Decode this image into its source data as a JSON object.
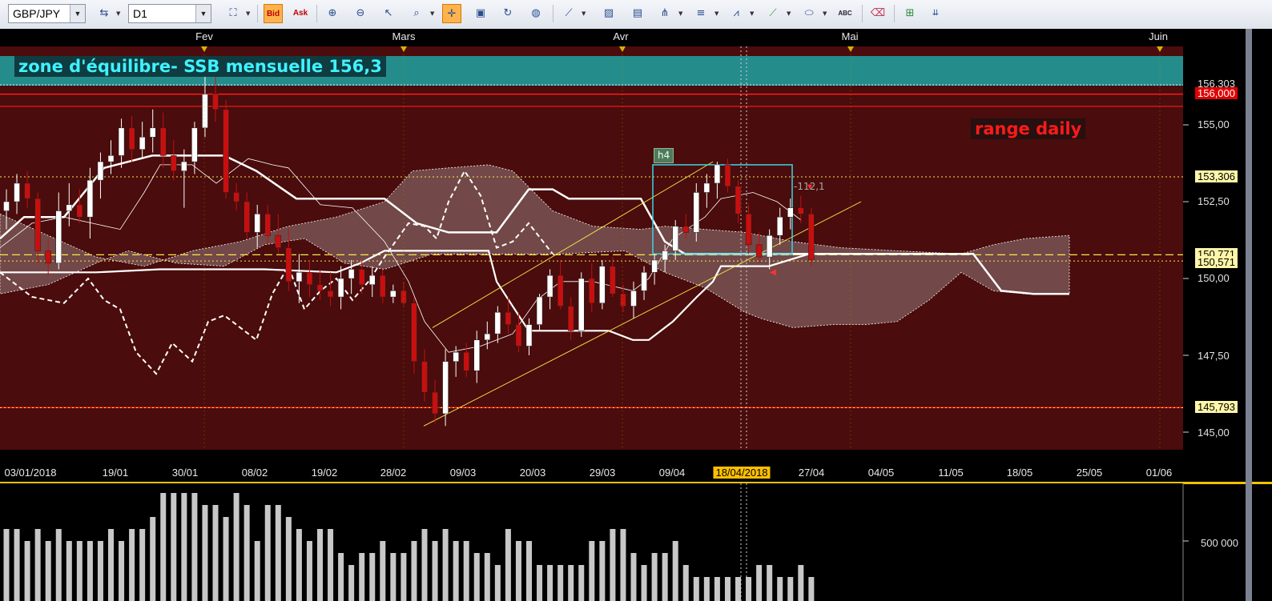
{
  "toolbar": {
    "symbol": "GBP/JPY",
    "timeframe": "D1",
    "bid_label": "Bid",
    "ask_label": "Ask",
    "abc_label": "ABC",
    "icons": [
      "connection-icon",
      "chart-type-icon",
      "bid-icon",
      "ask-icon",
      "zoom-in-icon",
      "zoom-out-icon",
      "cursor-icon",
      "magnifier-icon",
      "crosshair-icon",
      "screenshot-icon",
      "refresh-icon",
      "globe-icon",
      "ruler-icon",
      "image-icon",
      "template-icon",
      "pitchfork-icon",
      "horizontal-lines-icon",
      "fan-icon",
      "trendline-icon",
      "ellipse-icon",
      "text-tool-icon",
      "eraser-icon",
      "tree-icon",
      "more-icon"
    ]
  },
  "colors": {
    "background": "#4a0c0c",
    "zone_band": "#1ea3a3",
    "cloud": "#7a5454",
    "red_line": "#ff1a1a",
    "yellow_line": "#f7e84a",
    "candle_up": "#ffffff",
    "candle_down": "#c80f0f"
  },
  "month_labels": [
    "Fev",
    "Mars",
    "Avr",
    "Mai",
    "Juin"
  ],
  "date_labels": [
    "03/01/2018",
    "19/01",
    "30/01",
    "08/02",
    "19/02",
    "28/02",
    "09/03",
    "20/03",
    "29/03",
    "09/04",
    "18/04/2018",
    "27/04",
    "04/05",
    "11/05",
    "18/05",
    "25/05",
    "01/06"
  ],
  "annotations": {
    "zone": "zone d'équilibre- SSB mensuelle 156,3",
    "range": "range daily",
    "h4": "h4",
    "diff": "-112,1"
  },
  "price_labels": {
    "top_cut": "156,303",
    "p156": "156,000",
    "p155": "155,00",
    "p153306": "153,306",
    "p1525": "152,50",
    "p150771": "150,771",
    "p150571": "150,571",
    "p150": "150,00",
    "p1475": "147,50",
    "p145793": "145,793",
    "p145": "145,00"
  },
  "volume_label": "500 000",
  "chart_data": {
    "type": "candlestick",
    "symbol": "GBP/JPY",
    "timeframe": "D1",
    "ylim": [
      144.6,
      157.0
    ],
    "yticks": [
      145.0,
      147.5,
      150.0,
      152.5,
      155.0
    ],
    "levels": {
      "zone_top": 156.3,
      "red_upper": 156.0,
      "red_lower": 145.8,
      "dotted_153": 153.306,
      "dotted_150": 150.571,
      "yellow_dash": 150.771,
      "dotted_145": 145.793
    },
    "candles": [
      [
        152.2,
        152.9,
        151.6,
        152.5
      ],
      [
        152.5,
        153.4,
        152.1,
        153.1
      ],
      [
        153.1,
        153.5,
        152.3,
        152.6
      ],
      [
        152.6,
        152.8,
        150.5,
        150.9
      ],
      [
        150.9,
        151.3,
        150.1,
        150.5
      ],
      [
        150.5,
        152.8,
        150.3,
        152.2
      ],
      [
        152.2,
        153.1,
        151.7,
        152.4
      ],
      [
        152.4,
        152.9,
        151.8,
        152.0
      ],
      [
        152.0,
        153.6,
        151.3,
        153.2
      ],
      [
        153.2,
        154.1,
        152.6,
        153.8
      ],
      [
        153.8,
        154.5,
        153.4,
        154.0
      ],
      [
        154.0,
        155.2,
        153.6,
        154.9
      ],
      [
        154.9,
        155.3,
        153.8,
        154.2
      ],
      [
        154.2,
        155.1,
        153.9,
        154.6
      ],
      [
        154.6,
        155.5,
        154.1,
        154.9
      ],
      [
        154.9,
        155.4,
        153.6,
        154.0
      ],
      [
        154.0,
        154.5,
        153.2,
        153.5
      ],
      [
        153.5,
        154.2,
        152.3,
        153.8
      ],
      [
        153.8,
        155.1,
        153.4,
        154.9
      ],
      [
        154.9,
        156.7,
        154.6,
        156.0
      ],
      [
        156.0,
        156.6,
        155.1,
        155.5
      ],
      [
        155.5,
        155.8,
        152.6,
        152.8
      ],
      [
        152.8,
        153.1,
        152.2,
        152.5
      ],
      [
        152.5,
        152.8,
        151.3,
        151.5
      ],
      [
        151.5,
        152.4,
        151.0,
        152.1
      ],
      [
        152.1,
        152.4,
        151.1,
        151.4
      ],
      [
        151.4,
        152.1,
        150.8,
        151.0
      ],
      [
        151.0,
        151.6,
        149.6,
        149.9
      ],
      [
        149.9,
        150.8,
        149.2,
        150.2
      ],
      [
        150.2,
        150.6,
        149.4,
        149.8
      ],
      [
        149.8,
        150.3,
        149.3,
        149.6
      ],
      [
        149.6,
        150.2,
        149.1,
        149.4
      ],
      [
        149.4,
        150.4,
        149.0,
        150.0
      ],
      [
        150.0,
        150.6,
        149.5,
        150.3
      ],
      [
        150.3,
        150.6,
        149.5,
        149.8
      ],
      [
        149.8,
        150.4,
        149.4,
        150.1
      ],
      [
        150.1,
        150.3,
        149.2,
        149.4
      ],
      [
        149.4,
        149.8,
        149.2,
        149.6
      ],
      [
        149.6,
        149.9,
        149.1,
        149.2
      ],
      [
        149.2,
        149.4,
        146.9,
        147.3
      ],
      [
        147.3,
        147.7,
        146.0,
        146.3
      ],
      [
        146.3,
        146.7,
        145.3,
        145.6
      ],
      [
        145.6,
        147.7,
        145.2,
        147.3
      ],
      [
        147.3,
        147.8,
        146.8,
        147.6
      ],
      [
        147.6,
        147.9,
        146.8,
        147.0
      ],
      [
        147.0,
        148.3,
        146.6,
        148.0
      ],
      [
        148.0,
        148.6,
        147.7,
        148.2
      ],
      [
        148.2,
        149.1,
        147.9,
        148.9
      ],
      [
        148.9,
        149.4,
        148.2,
        148.5
      ],
      [
        148.5,
        148.9,
        147.6,
        147.8
      ],
      [
        147.8,
        148.7,
        147.5,
        148.5
      ],
      [
        148.5,
        149.5,
        148.3,
        149.4
      ],
      [
        149.4,
        150.3,
        149.0,
        150.1
      ],
      [
        150.1,
        150.6,
        149.0,
        149.1
      ],
      [
        149.1,
        149.4,
        148.0,
        148.3
      ],
      [
        148.3,
        150.2,
        148.1,
        150.0
      ],
      [
        150.0,
        150.5,
        148.9,
        149.2
      ],
      [
        149.2,
        150.6,
        149.0,
        150.4
      ],
      [
        150.4,
        150.7,
        149.4,
        149.5
      ],
      [
        149.5,
        149.8,
        148.9,
        149.1
      ],
      [
        149.1,
        149.9,
        148.7,
        149.6
      ],
      [
        149.6,
        150.4,
        149.3,
        150.2
      ],
      [
        150.2,
        150.8,
        149.8,
        150.6
      ],
      [
        150.6,
        151.1,
        150.2,
        150.9
      ],
      [
        150.9,
        151.9,
        150.6,
        151.7
      ],
      [
        151.7,
        152.1,
        151.3,
        151.5
      ],
      [
        151.5,
        153.1,
        151.2,
        152.8
      ],
      [
        152.8,
        153.4,
        152.3,
        153.1
      ],
      [
        153.1,
        153.8,
        152.6,
        153.7
      ],
      [
        153.7,
        153.9,
        152.8,
        153.0
      ],
      [
        153.0,
        153.2,
        151.8,
        152.1
      ],
      [
        152.1,
        152.4,
        150.8,
        151.1
      ],
      [
        151.1,
        151.5,
        150.5,
        150.7
      ],
      [
        150.7,
        151.6,
        150.3,
        151.4
      ],
      [
        151.4,
        152.3,
        151.1,
        152.0
      ],
      [
        152.0,
        152.6,
        151.6,
        152.3
      ],
      [
        152.3,
        152.7,
        151.8,
        152.1
      ],
      [
        152.1,
        152.3,
        150.4,
        150.6
      ]
    ],
    "volumes": [
      0.6,
      0.6,
      0.5,
      0.6,
      0.5,
      0.6,
      0.5,
      0.5,
      0.5,
      0.5,
      0.6,
      0.5,
      0.6,
      0.6,
      0.7,
      0.9,
      0.9,
      0.9,
      0.9,
      0.8,
      0.8,
      0.7,
      0.9,
      0.8,
      0.5,
      0.8,
      0.8,
      0.7,
      0.6,
      0.5,
      0.6,
      0.6,
      0.4,
      0.3,
      0.4,
      0.4,
      0.5,
      0.4,
      0.4,
      0.5,
      0.6,
      0.5,
      0.6,
      0.5,
      0.5,
      0.4,
      0.4,
      0.3,
      0.6,
      0.5,
      0.5,
      0.3,
      0.3,
      0.3,
      0.3,
      0.3,
      0.5,
      0.5,
      0.6,
      0.6,
      0.4,
      0.3,
      0.4,
      0.4,
      0.5,
      0.3,
      0.2,
      0.2,
      0.2,
      0.2,
      0.2,
      0.2,
      0.3,
      0.3,
      0.2,
      0.2,
      0.3,
      0.2
    ]
  }
}
